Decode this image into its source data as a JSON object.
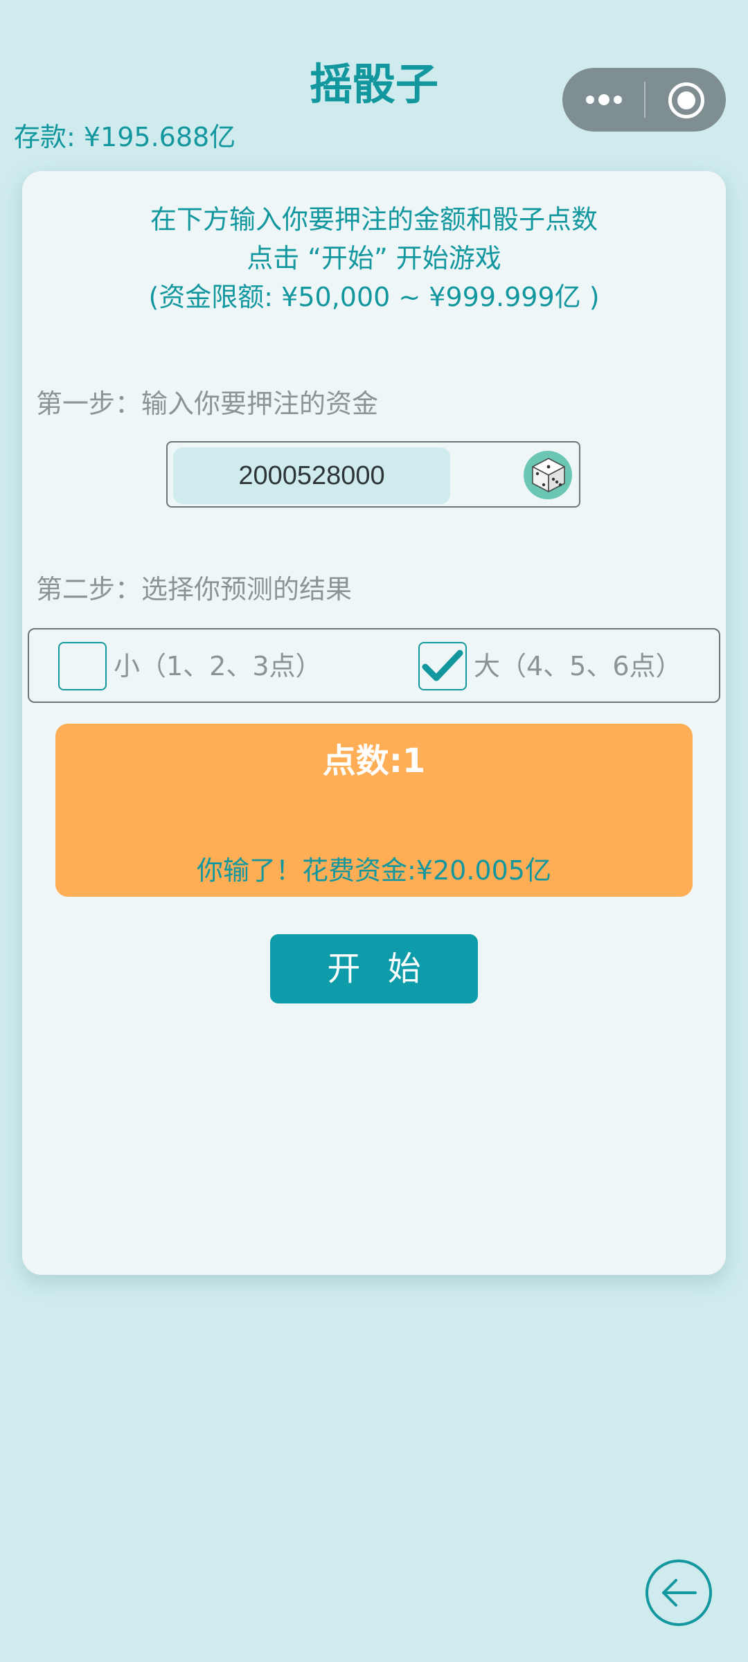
{
  "header": {
    "title": "摇骰子",
    "balance": "存款: ¥195.688亿"
  },
  "capsule": {
    "more_icon": "more-dots-icon",
    "close_icon": "target-circle-icon"
  },
  "instructions": {
    "line1": "在下方输入你要押注的金额和骰子点数",
    "line2": "点击 “开始” 开始游戏",
    "line3": "(资金限额: ¥50,000 ~ ¥999.999亿 )"
  },
  "step1": {
    "label": "第一步：输入你要押注的资金",
    "amount_value": "2000528000",
    "dice_icon": "dice-icon"
  },
  "step2": {
    "label": "第二步：选择你预测的结果",
    "options": [
      {
        "label": "小（1、2、3点）",
        "checked": false
      },
      {
        "label": "大（4、5、6点）",
        "checked": true
      }
    ]
  },
  "result": {
    "points": "点数:1",
    "message": "你输了！花费资金:¥20.005亿"
  },
  "start_label": "开 始",
  "colors": {
    "accent": "#12979f",
    "background": "#cfebee",
    "card": "#eff6f7",
    "result_panel": "#ffae56",
    "button": "#0e9caa"
  }
}
